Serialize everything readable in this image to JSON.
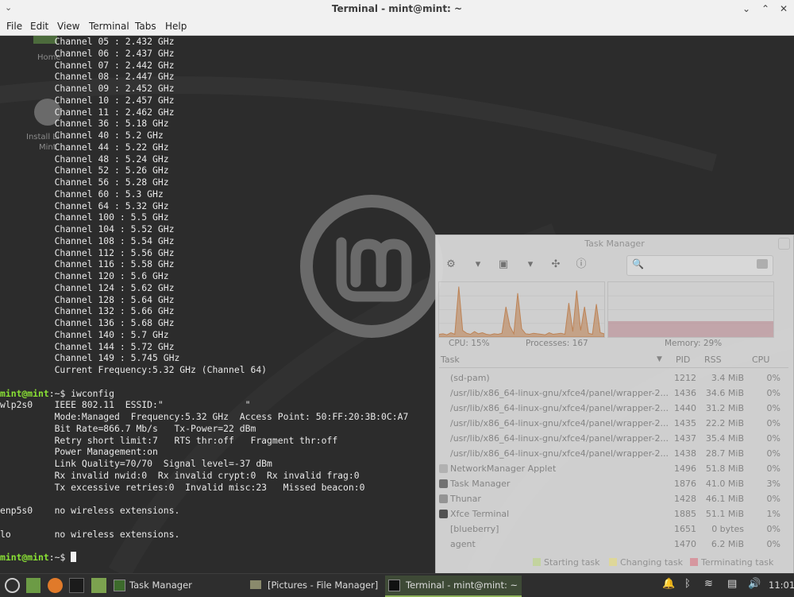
{
  "window": {
    "title": "Terminal - mint@mint: ~",
    "menu": [
      "File",
      "Edit",
      "View",
      "Terminal",
      "Tabs",
      "Help"
    ]
  },
  "desktop": {
    "icon_home": "Home",
    "icon_install_1": "Install Li",
    "icon_install_2": "Mint"
  },
  "terminal": {
    "lines": [
      "          Channel 05 : 2.432 GHz",
      "          Channel 06 : 2.437 GHz",
      "          Channel 07 : 2.442 GHz",
      "          Channel 08 : 2.447 GHz",
      "          Channel 09 : 2.452 GHz",
      "          Channel 10 : 2.457 GHz",
      "          Channel 11 : 2.462 GHz",
      "          Channel 36 : 5.18 GHz",
      "          Channel 40 : 5.2 GHz",
      "          Channel 44 : 5.22 GHz",
      "          Channel 48 : 5.24 GHz",
      "          Channel 52 : 5.26 GHz",
      "          Channel 56 : 5.28 GHz",
      "          Channel 60 : 5.3 GHz",
      "          Channel 64 : 5.32 GHz",
      "          Channel 100 : 5.5 GHz",
      "          Channel 104 : 5.52 GHz",
      "          Channel 108 : 5.54 GHz",
      "          Channel 112 : 5.56 GHz",
      "          Channel 116 : 5.58 GHz",
      "          Channel 120 : 5.6 GHz",
      "          Channel 124 : 5.62 GHz",
      "          Channel 128 : 5.64 GHz",
      "          Channel 132 : 5.66 GHz",
      "          Channel 136 : 5.68 GHz",
      "          Channel 140 : 5.7 GHz",
      "          Channel 144 : 5.72 GHz",
      "          Channel 149 : 5.745 GHz",
      "          Current Frequency:5.32 GHz (Channel 64)",
      "",
      "PROMPT:iwconfig",
      "wlp2s0    IEEE 802.11  ESSID:\"               \"",
      "          Mode:Managed  Frequency:5.32 GHz  Access Point: 50:FF:20:3B:0C:A7",
      "          Bit Rate=866.7 Mb/s   Tx-Power=22 dBm",
      "          Retry short limit:7   RTS thr:off   Fragment thr:off",
      "          Power Management:on",
      "          Link Quality=70/70  Signal level=-37 dBm",
      "          Rx invalid nwid:0  Rx invalid crypt:0  Rx invalid frag:0",
      "          Tx excessive retries:0  Invalid misc:23   Missed beacon:0",
      "",
      "enp5s0    no wireless extensions.",
      "",
      "lo        no wireless extensions.",
      "",
      "PROMPT:"
    ],
    "prompt": "mint@mint",
    "prompt_suffix": ":~$ "
  },
  "task_manager": {
    "title": "Task Manager",
    "cpu_label": "CPU: 15%",
    "processes_label": "Processes: 167",
    "memory_label": "Memory: 29%",
    "columns": {
      "task": "Task",
      "pid": "PID",
      "rss": "RSS",
      "cpu": "CPU"
    },
    "rows": [
      {
        "task": "(sd-pam)",
        "pid": "1212",
        "rss": "3.4 MiB",
        "cpu": "0%",
        "icon": ""
      },
      {
        "task": "/usr/lib/x86_64-linux-gnu/xfce4/panel/wrapper-2...",
        "pid": "1436",
        "rss": "34.6 MiB",
        "cpu": "0%",
        "icon": ""
      },
      {
        "task": "/usr/lib/x86_64-linux-gnu/xfce4/panel/wrapper-2...",
        "pid": "1440",
        "rss": "31.2 MiB",
        "cpu": "0%",
        "icon": ""
      },
      {
        "task": "/usr/lib/x86_64-linux-gnu/xfce4/panel/wrapper-2...",
        "pid": "1435",
        "rss": "22.2 MiB",
        "cpu": "0%",
        "icon": ""
      },
      {
        "task": "/usr/lib/x86_64-linux-gnu/xfce4/panel/wrapper-2...",
        "pid": "1437",
        "rss": "35.4 MiB",
        "cpu": "0%",
        "icon": ""
      },
      {
        "task": "/usr/lib/x86_64-linux-gnu/xfce4/panel/wrapper-2...",
        "pid": "1438",
        "rss": "28.7 MiB",
        "cpu": "0%",
        "icon": ""
      },
      {
        "task": "NetworkManager Applet",
        "pid": "1496",
        "rss": "51.8 MiB",
        "cpu": "0%",
        "icon": "#bcbcbc"
      },
      {
        "task": "Task Manager",
        "pid": "1876",
        "rss": "41.0 MiB",
        "cpu": "3%",
        "icon": "#777777"
      },
      {
        "task": "Thunar",
        "pid": "1428",
        "rss": "46.1 MiB",
        "cpu": "0%",
        "icon": "#9c9c9c"
      },
      {
        "task": "Xfce Terminal",
        "pid": "1885",
        "rss": "51.1 MiB",
        "cpu": "1%",
        "icon": "#555555"
      },
      {
        "task": "[blueberry]",
        "pid": "1651",
        "rss": "0 bytes",
        "cpu": "0%",
        "icon": ""
      },
      {
        "task": "agent",
        "pid": "1470",
        "rss": "6.2 MiB",
        "cpu": "0%",
        "icon": ""
      }
    ],
    "legend": {
      "starting": "Starting task",
      "changing": "Changing task",
      "terminating": "Terminating task",
      "starting_color": "#cfe0a8",
      "changing_color": "#ece5a2",
      "terminating_color": "#e3a0a8"
    },
    "cpu_history": [
      0.05,
      0.06,
      0.04,
      0.08,
      0.05,
      0.92,
      0.12,
      0.07,
      0.05,
      0.1,
      0.06,
      0.08,
      0.05,
      0.04,
      0.06,
      0.05,
      0.07,
      0.55,
      0.2,
      0.06,
      0.8,
      0.15,
      0.06,
      0.05,
      0.07,
      0.06,
      0.05,
      0.04,
      0.08,
      0.05,
      0.06,
      0.07,
      0.05,
      0.62,
      0.1,
      0.85,
      0.12,
      0.55,
      0.07,
      0.05,
      0.6,
      0.08,
      0.06
    ],
    "memory_fraction": 0.29
  },
  "taskbar": {
    "items": [
      {
        "label": "Task Manager",
        "active": false
      },
      {
        "label": "[Pictures - File Manager]",
        "active": false
      },
      {
        "label": "Terminal - mint@mint: ~",
        "active": true
      }
    ],
    "clock": "11:01"
  },
  "colors": {
    "prompt_green": "#8ae234",
    "cpu_graph": "#c88a5a",
    "mem_graph": "#c38a93"
  }
}
